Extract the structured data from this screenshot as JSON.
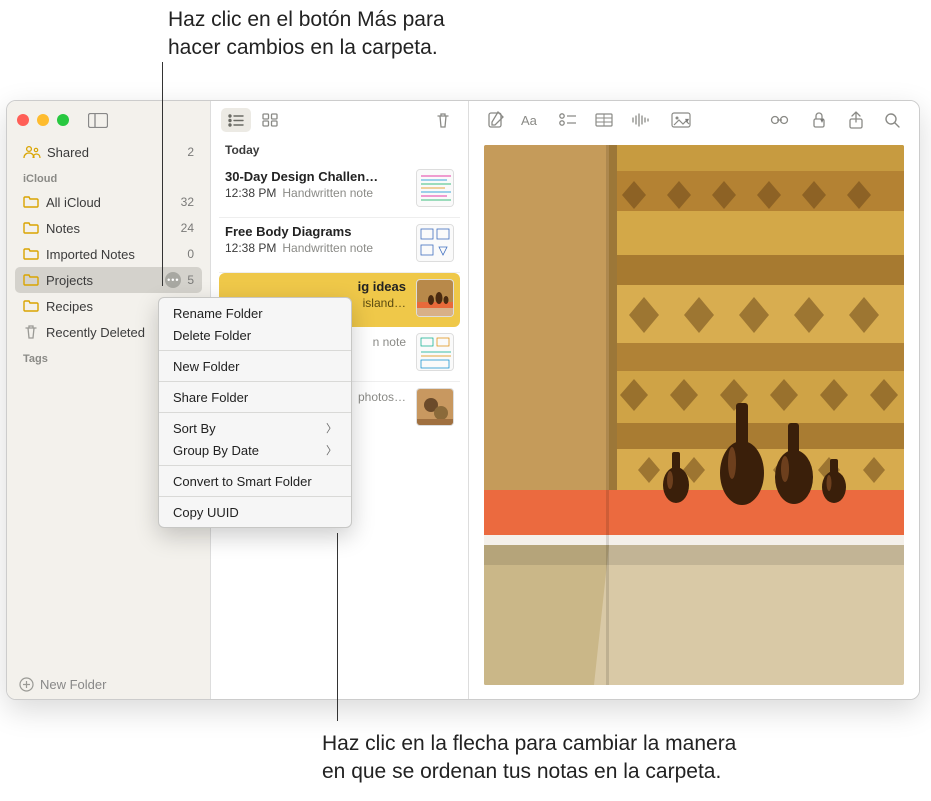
{
  "callouts": {
    "top": "Haz clic en el botón Más para\nhacer cambios en la carpeta.",
    "bottom": "Haz clic en la flecha para cambiar la manera\nen que se ordenan tus notas en la carpeta."
  },
  "sidebar": {
    "shared": {
      "label": "Shared",
      "count": "2"
    },
    "section_icloud": "iCloud",
    "folders": [
      {
        "label": "All iCloud",
        "count": "32"
      },
      {
        "label": "Notes",
        "count": "24"
      },
      {
        "label": "Imported Notes",
        "count": "0"
      },
      {
        "label": "Projects",
        "count": "5"
      },
      {
        "label": "Recipes"
      },
      {
        "label": "Recently Deleted"
      }
    ],
    "section_tags": "Tags",
    "footer": "New Folder"
  },
  "noteslist": {
    "header": "Today",
    "rows": [
      {
        "title": "30-Day Design Challen…",
        "time": "12:38 PM",
        "snippet": "Handwritten note"
      },
      {
        "title": "Free Body Diagrams",
        "time": "12:38 PM",
        "snippet": "Handwritten note"
      },
      {
        "title": "ig ideas",
        "time": "",
        "snippet": "island…"
      },
      {
        "title": "",
        "time": "",
        "snippet": "n note"
      },
      {
        "title": "",
        "time": "",
        "snippet": "photos…"
      }
    ]
  },
  "ctx": {
    "rename": "Rename Folder",
    "delete": "Delete Folder",
    "newfolder": "New Folder",
    "share": "Share Folder",
    "sortby": "Sort By",
    "groupby": "Group By Date",
    "convert": "Convert to Smart Folder",
    "copyuuid": "Copy UUID"
  },
  "icons": {
    "sidebar_toggle": "sidebar-toggle-icon",
    "list_view": "list-view-icon",
    "grid_view": "grid-view-icon",
    "trash": "trash-icon",
    "compose": "compose-icon",
    "format": "format-icon",
    "checklist": "checklist-icon",
    "table": "table-icon",
    "media_wave": "media-wave-icon",
    "image": "image-icon",
    "link": "link-icon",
    "lock": "lock-icon",
    "share": "share-icon",
    "search": "search-icon",
    "more": "more-icon",
    "plus_circle": "plus-circle-icon"
  },
  "colors": {
    "accent_yellow": "#efc849",
    "sidebar_bg": "#f3f1ec",
    "selection_gray": "#d4d2cc"
  }
}
